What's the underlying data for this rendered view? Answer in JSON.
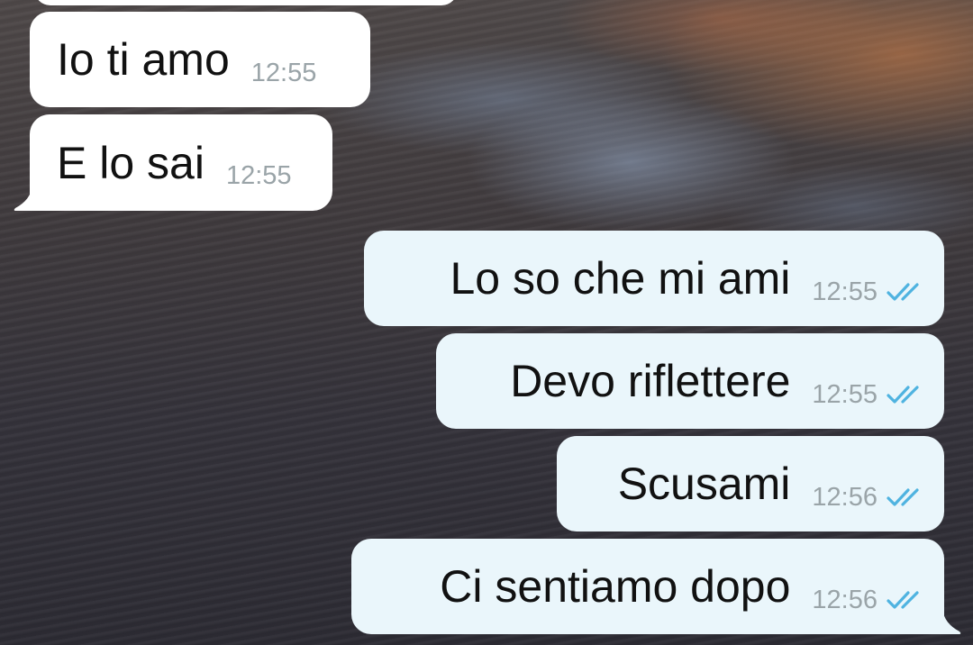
{
  "messages": [
    {
      "text": "Io ti amo",
      "time": "12:55"
    },
    {
      "text": "E lo sai",
      "time": "12:55"
    },
    {
      "text": "Lo so che mi ami",
      "time": "12:55"
    },
    {
      "text": "Devo riflettere",
      "time": "12:55"
    },
    {
      "text": "Scusami",
      "time": "12:56"
    },
    {
      "text": "Ci sentiamo dopo",
      "time": "12:56"
    }
  ],
  "colors": {
    "incoming_bubble": "#ffffff",
    "outgoing_bubble": "#eaf6fb",
    "timestamp": "#9aa4a8",
    "read_ticks": "#4fb3e0"
  },
  "icons": {
    "read_receipt": "double-check-icon"
  }
}
